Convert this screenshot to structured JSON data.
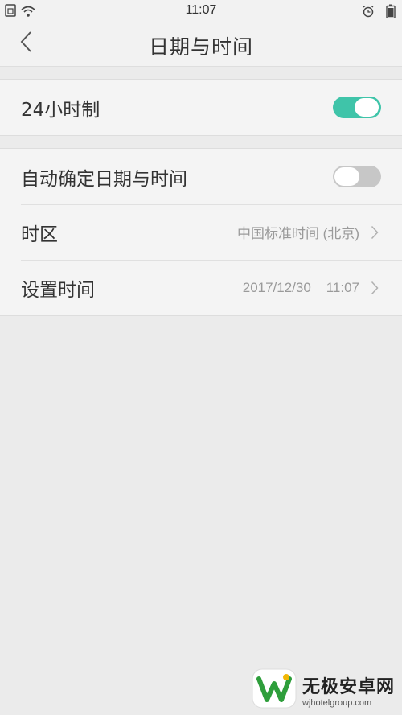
{
  "status_bar": {
    "time": "11:07",
    "icons": [
      "sim-icon",
      "wifi-icon",
      "alarm-icon",
      "battery-icon"
    ]
  },
  "nav": {
    "back_icon": "back-chevron-icon",
    "title": "日期与时间"
  },
  "settings": {
    "hour24": {
      "label": "24小时制",
      "enabled": true
    },
    "auto_datetime": {
      "label": "自动确定日期与时间",
      "enabled": false
    },
    "timezone": {
      "label": "时区",
      "value": "中国标准时间 (北京)"
    },
    "set_time": {
      "label": "设置时间",
      "value": "2017/12/30    11:07"
    }
  },
  "watermark": {
    "title": "无极安卓网",
    "subtitle": "wjhotelgroup.com"
  },
  "colors": {
    "toggle_on": "#3fc4a9",
    "toggle_off": "#c7c7c7",
    "background": "#ebebeb",
    "watermark_green": "#2e9e3b"
  }
}
